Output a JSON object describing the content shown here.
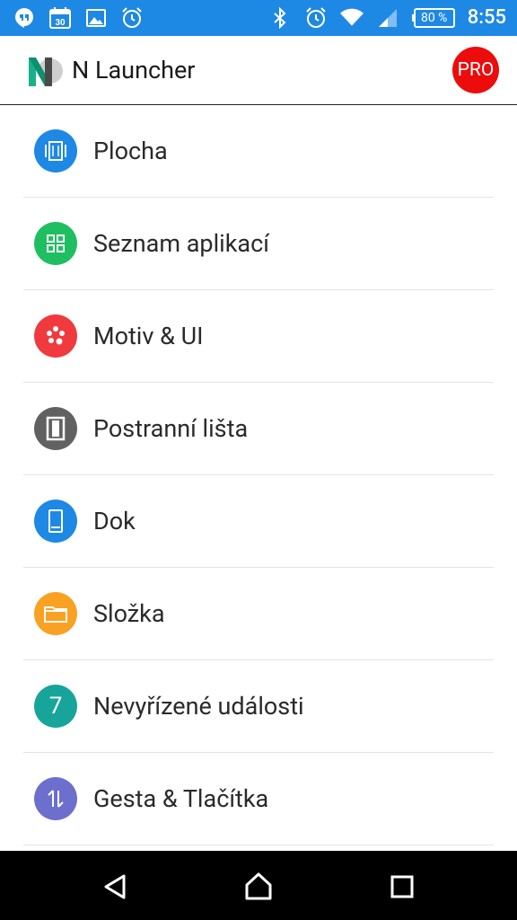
{
  "status_bar": {
    "time": "8:55",
    "battery": "80 %",
    "calendar_day": "30",
    "left_icons": [
      "hangouts-icon",
      "calendar-icon",
      "image-icon",
      "alarm-app-icon"
    ],
    "right_icons": [
      "bluetooth-icon",
      "alarm-icon",
      "wifi-icon",
      "signal-icon",
      "battery-icon"
    ]
  },
  "app_bar": {
    "title": "N Launcher",
    "pro_label": "PRO"
  },
  "menu": {
    "items": [
      {
        "label": "Plocha",
        "icon": "desktop-icon",
        "color": "#1e88e5"
      },
      {
        "label": "Seznam aplikací",
        "icon": "grid-icon",
        "color": "#1fbf61"
      },
      {
        "label": "Motiv & UI",
        "icon": "palette-icon",
        "color": "#f03a3e"
      },
      {
        "label": "Postranní lišta",
        "icon": "sidebar-icon",
        "color": "#616161"
      },
      {
        "label": "Dok",
        "icon": "phone-icon",
        "color": "#1e88e5"
      },
      {
        "label": "Složka",
        "icon": "folder-icon",
        "color": "#f9a123"
      },
      {
        "label": "Nevyřízené události",
        "icon": "badge-icon",
        "icon_text": "7",
        "color": "#17a59b"
      },
      {
        "label": "Gesta & Tlačítka",
        "icon": "gesture-icon",
        "color": "#6c6fcc"
      }
    ]
  },
  "nav_bar": {
    "icons": [
      "back-icon",
      "home-icon",
      "recents-icon"
    ]
  },
  "colors": {
    "status_bar": "#1e88e5",
    "pro": "#ec0c0c",
    "logo_green": "#16b289"
  }
}
